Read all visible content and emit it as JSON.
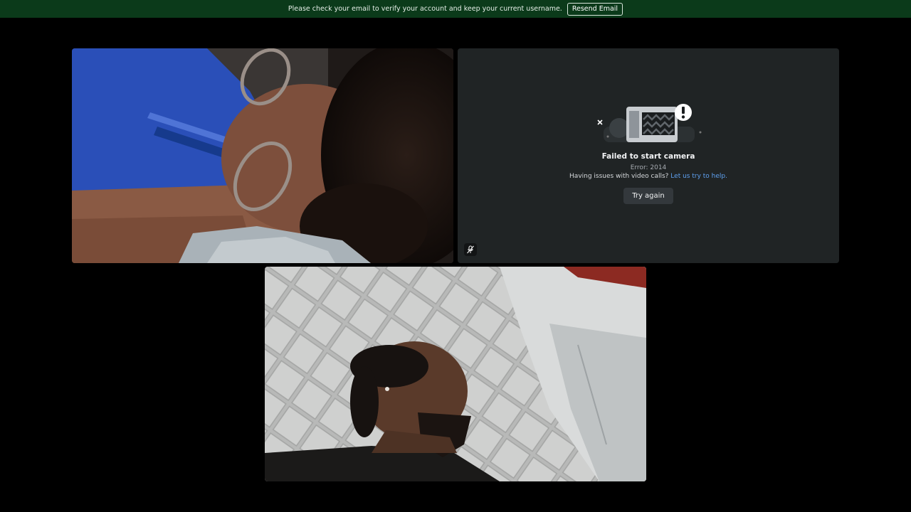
{
  "notice": {
    "message": "Please check your email to verify your account and keep your current username.",
    "resend_label": "Resend Email"
  },
  "tiles": {
    "camera_error": {
      "title": "Failed to start camera",
      "code": "Error: 2014",
      "help_text": "Having issues with video calls?",
      "help_link": "Let us try to help.",
      "retry_label": "Try again",
      "icons": [
        "broken-camera-icon",
        "alert-icon",
        "mic-muted-icon"
      ]
    }
  },
  "colors": {
    "notice_bg": "#0b3a1a",
    "tile_bg": "#202425",
    "link": "#5ea0f0"
  }
}
